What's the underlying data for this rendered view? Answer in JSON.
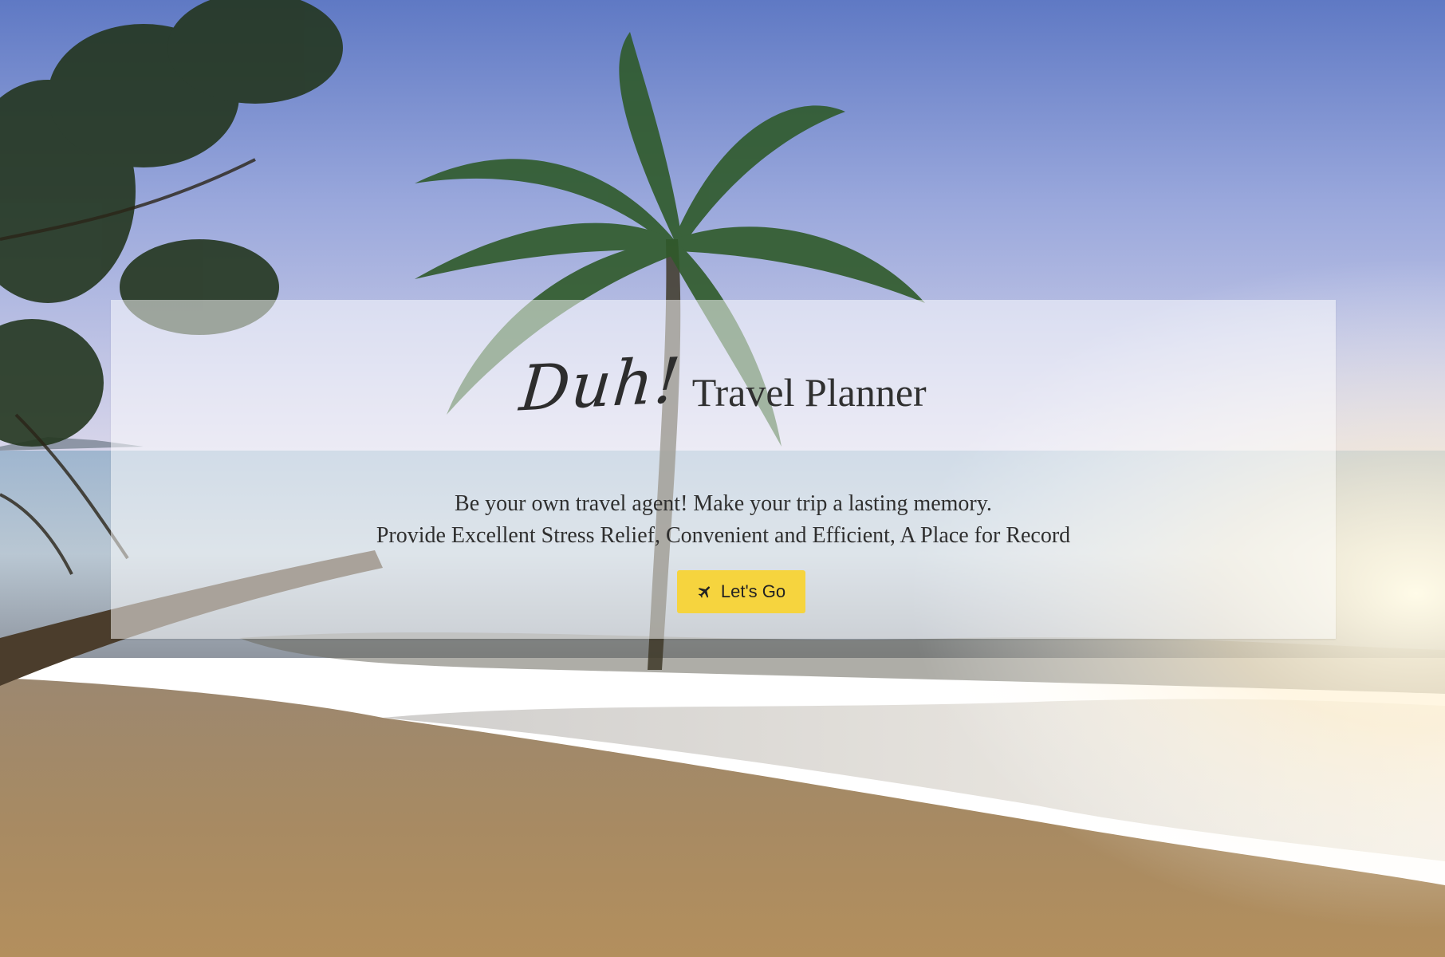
{
  "hero": {
    "brand_mark": "Duh!",
    "app_name": "Travel Planner",
    "tagline_line1": "Be your own travel agent! Make your trip a lasting memory.",
    "tagline_line2": "Provide Excellent Stress Relief, Convenient and Efficient, A Place for Record",
    "cta": {
      "label": "Let's Go",
      "icon": "airplane-icon",
      "color": "#f6d43e"
    }
  },
  "background": {
    "scene": "beach-photo"
  }
}
